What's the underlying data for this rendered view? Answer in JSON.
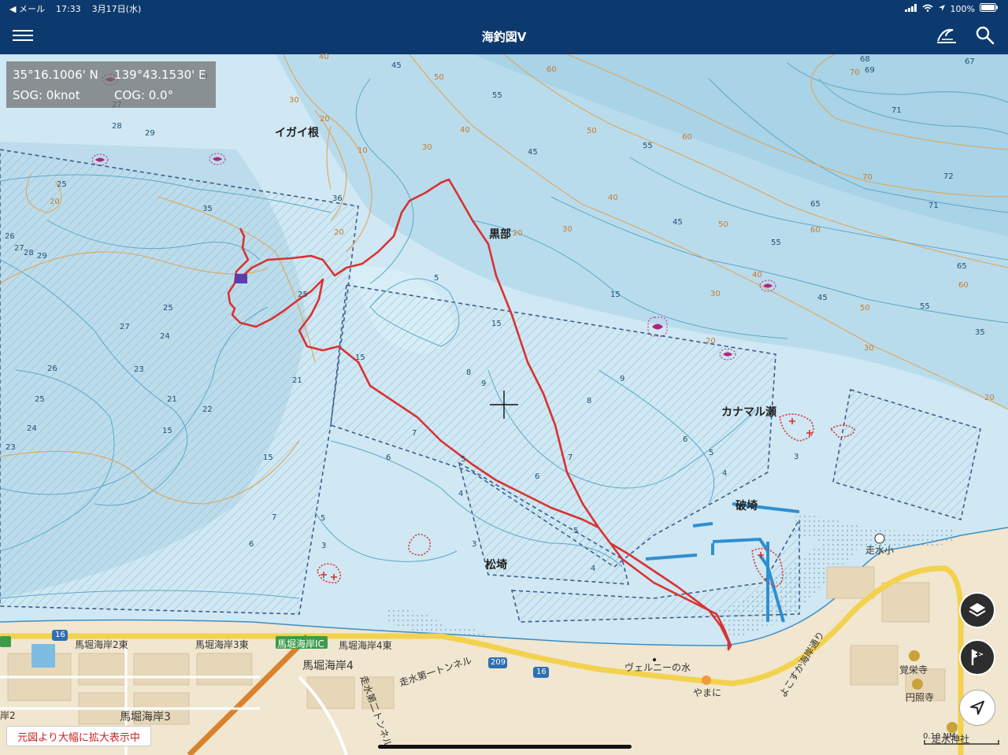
{
  "status_bar": {
    "back_app": "◀ メール",
    "time": "17:33",
    "date": "3月17日(水)",
    "battery": "100%"
  },
  "app": {
    "title": "海釣図V"
  },
  "info_panel": {
    "lat": "35°16.1006' N",
    "lon": "139°43.1530' E",
    "sog": "SOG: 0knot",
    "cog": "COG: 0.0°"
  },
  "places": {
    "igai_ne": "イガイ根",
    "kurobe": "黒部",
    "kanamaru": "カナマル瀬",
    "hasaki": "破埼",
    "matsuzaki": "松埼"
  },
  "roads": {
    "maborikaigan2": "馬堀海岸2東",
    "maborikaigan3": "馬堀海岸3東",
    "maborikaigan_ic": "馬堀海岸IC",
    "maborikaigan4e": "馬堀海岸4東",
    "maborikaigan4": "馬堀海岸4",
    "maborikaigan3b": "馬堀海岸3",
    "tunnel1": "走水第一トンネル",
    "tunnel2": "走水第二トンネル",
    "verny": "ヴェルニーの水",
    "yamani": "やまに",
    "yokosuka": "よこすか海岸通り",
    "hashirimizu_sho": "走水小",
    "kakuei": "覚栄寺",
    "enshou": "円照寺",
    "hashirimizu_jinja": "走水神社",
    "route16a": "16",
    "route16b": "16",
    "route209": "209",
    "kai2": "岸2"
  },
  "zoom_note": "元図より大幅に拡大表示中",
  "scale": "0.10 NM",
  "depth_labels": [
    "45",
    "55",
    "68",
    "67",
    "69",
    "71",
    "72",
    "71",
    "29",
    "27",
    "28",
    "25",
    "26",
    "27",
    "28",
    "29",
    "25",
    "27",
    "24",
    "26",
    "23",
    "25",
    "24",
    "23",
    "21",
    "22",
    "15",
    "15",
    "15",
    "15",
    "5",
    "15",
    "9",
    "8",
    "8",
    "9",
    "7",
    "6",
    "6",
    "5",
    "4",
    "5",
    "3",
    "7",
    "6",
    "7",
    "6",
    "5",
    "4",
    "3",
    "3",
    "5",
    "4",
    "45",
    "45",
    "55",
    "55",
    "65",
    "65",
    "55",
    "45",
    "35",
    "30",
    "25",
    "21",
    "35",
    "36"
  ],
  "contour_labels": [
    "40",
    "50",
    "60",
    "70",
    "30",
    "20",
    "10",
    "30",
    "40",
    "50",
    "60",
    "70",
    "20",
    "30",
    "40",
    "50",
    "60",
    "20",
    "30",
    "40",
    "50",
    "60",
    "20",
    "30",
    "20",
    "20"
  ],
  "colors": {
    "sea": "#cfe8f3",
    "land": "#f1e6cf",
    "nav": "#0d3a6e",
    "track": "#d83232",
    "contour": "#e0a55a",
    "road": "#f2d24e",
    "highway": "#d9822b"
  }
}
